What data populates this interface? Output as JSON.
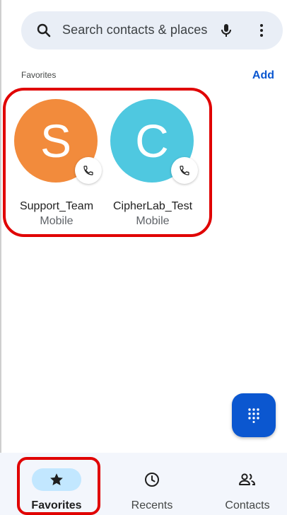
{
  "search": {
    "placeholder": "Search contacts & places"
  },
  "favorites": {
    "title": "Favorites",
    "add_label": "Add",
    "items": [
      {
        "initial": "S",
        "name": "Support_Team",
        "type": "Mobile",
        "color": "#f28b3c"
      },
      {
        "initial": "C",
        "name": "CipherLab_Test",
        "type": "Mobile",
        "color": "#4fc8e0"
      }
    ]
  },
  "bottom_nav": {
    "items": [
      {
        "label": "Favorites",
        "icon": "star-icon",
        "active": true
      },
      {
        "label": "Recents",
        "icon": "clock-icon",
        "active": false
      },
      {
        "label": "Contacts",
        "icon": "people-icon",
        "active": false
      }
    ]
  },
  "colors": {
    "accent": "#0b57d0",
    "highlight": "#e00000"
  }
}
